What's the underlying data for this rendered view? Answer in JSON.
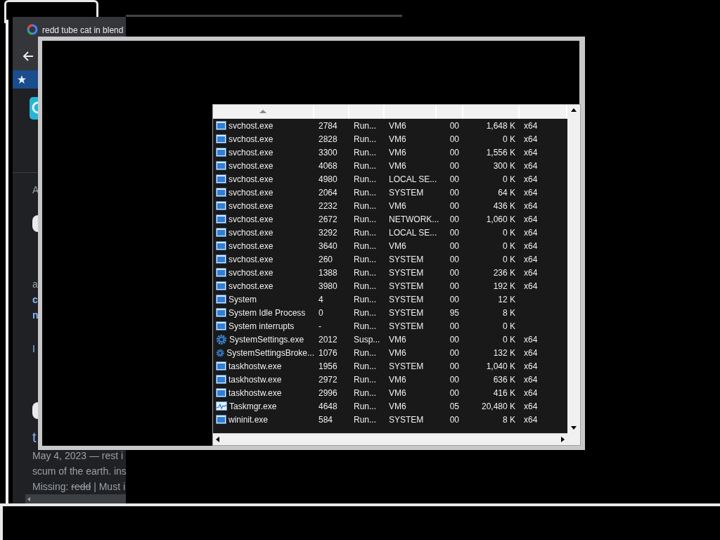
{
  "browser": {
    "tab_title": "redd tube cat in blend",
    "results": [
      {
        "kind": "snippet",
        "text": "A"
      },
      {
        "kind": "avatar"
      },
      {
        "kind": "snippet",
        "text": "a"
      },
      {
        "kind": "link",
        "text": "c"
      },
      {
        "kind": "link",
        "text": "n"
      },
      {
        "kind": "plainlink",
        "text": "I"
      },
      {
        "kind": "avatar"
      },
      {
        "kind": "title",
        "text": "t"
      },
      {
        "kind": "snippet",
        "text": "May 4, 2023 — rest i"
      },
      {
        "kind": "snippet",
        "text": "scum of the earth. ins"
      },
      {
        "kind": "missing",
        "text": "Missing:",
        "struck": "redd",
        "rest": "| Must i"
      }
    ]
  },
  "process_table": {
    "rows": [
      {
        "kind": "app",
        "name": "svchost.exe",
        "pid": "2784",
        "status": "Run...",
        "user": "VM6",
        "cpu": "00",
        "memory": "1,648 K",
        "arch": "x64"
      },
      {
        "kind": "app",
        "name": "svchost.exe",
        "pid": "2828",
        "status": "Run...",
        "user": "VM6",
        "cpu": "00",
        "memory": "0 K",
        "arch": "x64"
      },
      {
        "kind": "app",
        "name": "svchost.exe",
        "pid": "3300",
        "status": "Run...",
        "user": "VM6",
        "cpu": "00",
        "memory": "1,556 K",
        "arch": "x64"
      },
      {
        "kind": "app",
        "name": "svchost.exe",
        "pid": "4068",
        "status": "Run...",
        "user": "VM6",
        "cpu": "00",
        "memory": "300 K",
        "arch": "x64"
      },
      {
        "kind": "app",
        "name": "svchost.exe",
        "pid": "4980",
        "status": "Run...",
        "user": "LOCAL SE...",
        "cpu": "00",
        "memory": "0 K",
        "arch": "x64"
      },
      {
        "kind": "app",
        "name": "svchost.exe",
        "pid": "2064",
        "status": "Run...",
        "user": "SYSTEM",
        "cpu": "00",
        "memory": "64 K",
        "arch": "x64"
      },
      {
        "kind": "app",
        "name": "svchost.exe",
        "pid": "2232",
        "status": "Run...",
        "user": "VM6",
        "cpu": "00",
        "memory": "436 K",
        "arch": "x64"
      },
      {
        "kind": "app",
        "name": "svchost.exe",
        "pid": "2672",
        "status": "Run...",
        "user": "NETWORK...",
        "cpu": "00",
        "memory": "1,060 K",
        "arch": "x64"
      },
      {
        "kind": "app",
        "name": "svchost.exe",
        "pid": "3292",
        "status": "Run...",
        "user": "LOCAL SE...",
        "cpu": "00",
        "memory": "0 K",
        "arch": "x64"
      },
      {
        "kind": "app",
        "name": "svchost.exe",
        "pid": "3640",
        "status": "Run...",
        "user": "VM6",
        "cpu": "00",
        "memory": "0 K",
        "arch": "x64"
      },
      {
        "kind": "app",
        "name": "svchost.exe",
        "pid": "260",
        "status": "Run...",
        "user": "SYSTEM",
        "cpu": "00",
        "memory": "0 K",
        "arch": "x64"
      },
      {
        "kind": "app",
        "name": "svchost.exe",
        "pid": "1388",
        "status": "Run...",
        "user": "SYSTEM",
        "cpu": "00",
        "memory": "236 K",
        "arch": "x64"
      },
      {
        "kind": "app",
        "name": "svchost.exe",
        "pid": "3980",
        "status": "Run...",
        "user": "SYSTEM",
        "cpu": "00",
        "memory": "192 K",
        "arch": "x64"
      },
      {
        "kind": "app",
        "name": "System",
        "pid": "4",
        "status": "Run...",
        "user": "SYSTEM",
        "cpu": "00",
        "memory": "12 K"
      },
      {
        "kind": "app",
        "name": "System Idle Process",
        "pid": "0",
        "status": "Run...",
        "user": "SYSTEM",
        "cpu": "95",
        "memory": "8 K"
      },
      {
        "kind": "app",
        "name": "System interrupts",
        "pid": "-",
        "status": "Run...",
        "user": "SYSTEM",
        "cpu": "00",
        "memory": "0 K"
      },
      {
        "kind": "gear",
        "name": "SystemSettings.exe",
        "pid": "2012",
        "status": "Susp...",
        "user": "VM6",
        "cpu": "00",
        "memory": "0 K",
        "arch": "x64"
      },
      {
        "kind": "gear",
        "name": "SystemSettingsBroke...",
        "pid": "1076",
        "status": "Run...",
        "user": "VM6",
        "cpu": "00",
        "memory": "132 K",
        "arch": "x64"
      },
      {
        "kind": "app",
        "name": "taskhostw.exe",
        "pid": "1956",
        "status": "Run...",
        "user": "SYSTEM",
        "cpu": "00",
        "memory": "1,040 K",
        "arch": "x64"
      },
      {
        "kind": "app",
        "name": "taskhostw.exe",
        "pid": "2972",
        "status": "Run...",
        "user": "VM6",
        "cpu": "00",
        "memory": "636 K",
        "arch": "x64"
      },
      {
        "kind": "app",
        "name": "taskhostw.exe",
        "pid": "2996",
        "status": "Run...",
        "user": "VM6",
        "cpu": "00",
        "memory": "416 K",
        "arch": "x64"
      },
      {
        "kind": "monitor",
        "name": "Taskmgr.exe",
        "pid": "4648",
        "status": "Run...",
        "user": "VM6",
        "cpu": "05",
        "memory": "20,480 K",
        "arch": "x64"
      },
      {
        "kind": "app",
        "name": "wininit.exe",
        "pid": "584",
        "status": "Run...",
        "user": "SYSTEM",
        "cpu": "00",
        "memory": "8 K",
        "arch": "x64"
      }
    ]
  }
}
